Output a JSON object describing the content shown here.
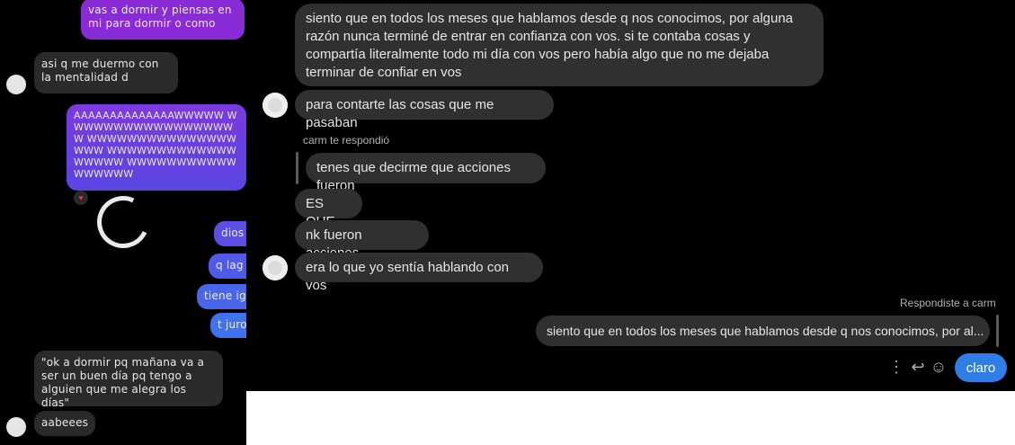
{
  "left_panel": {
    "messages": [
      {
        "text": "vas a dormir y piensas en mi para dormir o como"
      },
      {
        "text": "asi q me duermo con la mentalidad d"
      },
      {
        "text": "AAAAAAAAAAAAAAWWWWW WWWWWWWWWWWWWWWWWW WWWWWWWWWWWWWWWWWW WWWWWWWWWWWWWWWWWW WWWWWWWWWWWWWWWWW"
      },
      {
        "text": "dios"
      },
      {
        "text": "q lag"
      },
      {
        "text": "tiene ig"
      },
      {
        "text": "t juro"
      },
      {
        "text": "\"ok a dormir pq mañana va a ser un buen día pq tengo a alguien que me alegra los días\""
      },
      {
        "text": "aabeees"
      }
    ]
  },
  "chat": {
    "messages": [
      {
        "text": "siento que en todos los meses que hablamos desde q nos conocimos, por alguna razón nunca terminé de entrar en confianza con vos. si te contaba cosas y compartía literalmente todo mi día con vos pero había algo que no me dejaba terminar de confiar en vos"
      },
      {
        "text": "para contarte las cosas que me pasaban"
      },
      {
        "text": "tenes que decirme que acciones fueron"
      },
      {
        "text": "ES QUE"
      },
      {
        "text": "nk fueron acciones"
      },
      {
        "text": "era lo que yo sentía hablando con vos"
      }
    ],
    "reply_meta_received": "carm te respondió",
    "reply_meta_sent": "Respondiste a carm",
    "quoted_sent": "siento que en todos los meses que hablamos desde q nos conocimos, por al...",
    "sent_message": "claro",
    "actions": {
      "more": "⋮",
      "reply": "↩",
      "react": "☺"
    }
  }
}
